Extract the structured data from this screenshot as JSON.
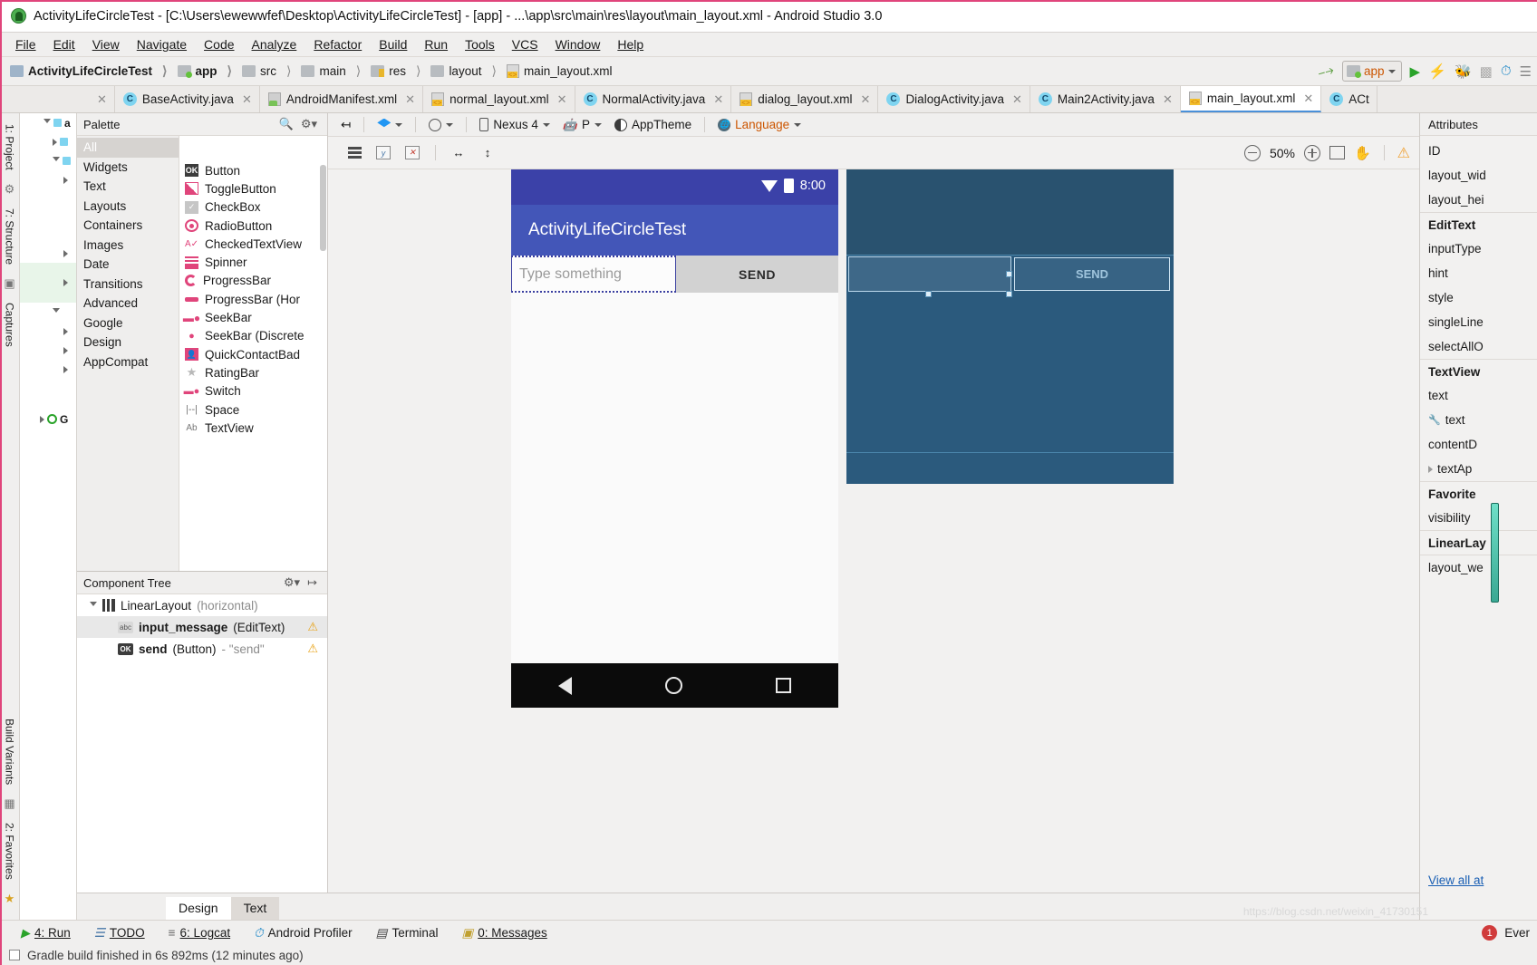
{
  "window": {
    "title": "ActivityLifeCircleTest - [C:\\Users\\ewewwfef\\Desktop\\ActivityLifeCircleTest] - [app] - ...\\app\\src\\main\\res\\layout\\main_layout.xml - Android Studio 3.0",
    "app_icon": "android-studio-icon"
  },
  "menubar": [
    {
      "label": "File"
    },
    {
      "label": "Edit"
    },
    {
      "label": "View"
    },
    {
      "label": "Navigate"
    },
    {
      "label": "Code"
    },
    {
      "label": "Analyze"
    },
    {
      "label": "Refactor"
    },
    {
      "label": "Build"
    },
    {
      "label": "Run"
    },
    {
      "label": "Tools"
    },
    {
      "label": "VCS"
    },
    {
      "label": "Window"
    },
    {
      "label": "Help"
    }
  ],
  "breadcrumbs": [
    {
      "label": "ActivityLifeCircleTest",
      "icon": "module-icon"
    },
    {
      "label": "app",
      "icon": "app-module-icon"
    },
    {
      "label": "src",
      "icon": "folder-icon"
    },
    {
      "label": "main",
      "icon": "folder-icon"
    },
    {
      "label": "res",
      "icon": "res-folder-icon"
    },
    {
      "label": "layout",
      "icon": "folder-icon"
    },
    {
      "label": "main_layout.xml",
      "icon": "xml-file-icon"
    }
  ],
  "toolbar_right": {
    "build_icon": "hammer-icon",
    "run_config": "app",
    "run_icon": "run-icon",
    "apply_changes_icon": "lightning-icon",
    "debug_icon": "debug-icon",
    "profile_icon": "profiler-icon",
    "avd_icon": "avd-manager-icon"
  },
  "editor_tabs": [
    {
      "label": "BaseActivity.java",
      "icon": "java-class-icon",
      "active": false
    },
    {
      "label": "AndroidManifest.xml",
      "icon": "android-manifest-icon",
      "active": false
    },
    {
      "label": "normal_layout.xml",
      "icon": "xml-file-icon",
      "active": false
    },
    {
      "label": "NormalActivity.java",
      "icon": "java-class-icon",
      "active": false
    },
    {
      "label": "dialog_layout.xml",
      "icon": "xml-file-icon",
      "active": false
    },
    {
      "label": "DialogActivity.java",
      "icon": "java-class-icon",
      "active": false
    },
    {
      "label": "Main2Activity.java",
      "icon": "java-class-icon",
      "active": false
    },
    {
      "label": "main_layout.xml",
      "icon": "xml-file-icon",
      "active": true
    },
    {
      "label": "ACt",
      "icon": "java-class-icon",
      "active": false
    }
  ],
  "left_tool_strip": [
    {
      "label": "1: Project"
    },
    {
      "label": "7: Structure"
    },
    {
      "label": "Captures"
    },
    {
      "label": "Build Variants"
    },
    {
      "label": "2: Favorites"
    }
  ],
  "palette": {
    "title": "Palette",
    "search_icon": "search-icon",
    "gear_icon": "gear-icon",
    "groups": [
      {
        "label": "All",
        "selected": true
      },
      {
        "label": "Widgets",
        "selected": false
      },
      {
        "label": "Text",
        "selected": false
      },
      {
        "label": "Layouts",
        "selected": false
      },
      {
        "label": "Containers",
        "selected": false
      },
      {
        "label": "Images",
        "selected": false
      },
      {
        "label": "Date",
        "selected": false
      },
      {
        "label": "Transitions",
        "selected": false
      },
      {
        "label": "Advanced",
        "selected": false
      },
      {
        "label": "Google",
        "selected": false
      },
      {
        "label": "Design",
        "selected": false
      },
      {
        "label": "AppCompat",
        "selected": false
      }
    ],
    "items": [
      {
        "label": "Button",
        "icon": "button-icon"
      },
      {
        "label": "ToggleButton",
        "icon": "toggle-button-icon"
      },
      {
        "label": "CheckBox",
        "icon": "checkbox-icon"
      },
      {
        "label": "RadioButton",
        "icon": "radio-button-icon"
      },
      {
        "label": "CheckedTextView",
        "icon": "checked-textview-icon"
      },
      {
        "label": "Spinner",
        "icon": "spinner-icon"
      },
      {
        "label": "ProgressBar",
        "icon": "progressbar-icon"
      },
      {
        "label": "ProgressBar (Hor",
        "icon": "progressbar-horizontal-icon"
      },
      {
        "label": "SeekBar",
        "icon": "seekbar-icon"
      },
      {
        "label": "SeekBar (Discrete",
        "icon": "seekbar-discrete-icon"
      },
      {
        "label": "QuickContactBad",
        "icon": "quick-contact-badge-icon"
      },
      {
        "label": "RatingBar",
        "icon": "ratingbar-icon"
      },
      {
        "label": "Switch",
        "icon": "switch-icon"
      },
      {
        "label": "Space",
        "icon": "space-icon"
      },
      {
        "label": "TextView",
        "icon": "textview-icon"
      }
    ]
  },
  "component_tree": {
    "title": "Component Tree",
    "gear_icon": "gear-icon",
    "nodes": [
      {
        "name": "LinearLayout",
        "type": "(horizontal)",
        "value": "",
        "icon": "linearlayout-icon",
        "indent": false,
        "selected": false,
        "warning": false
      },
      {
        "name": "input_message",
        "type": "(EditText)",
        "value": "",
        "icon": "edittext-icon",
        "indent": true,
        "selected": true,
        "warning": true
      },
      {
        "name": "send",
        "type": "(Button)",
        "value": " - \"send\"",
        "icon": "button-icon",
        "indent": true,
        "selected": false,
        "warning": true
      }
    ]
  },
  "design_toolbar": {
    "collapse_icon": "collapse-panel-icon",
    "layers_label": "design-mode-icon",
    "orientation_icon": "orientation-icon",
    "device": "Nexus 4",
    "api_level": "P",
    "theme": "AppTheme",
    "language": "Language",
    "device_icon": "phone-icon",
    "api_icon": "android-icon",
    "theme_icon": "theme-icon",
    "language_icon": "globe-icon"
  },
  "design_toolbar2": {
    "list_icon": "list-view-icon",
    "baseline_icon": "baseline-icon",
    "clear_constraints_icon": "clear-constraints-icon",
    "width_icon": "horizontal-resize-icon",
    "height_icon": "vertical-resize-icon",
    "zoom_out_icon": "zoom-out-icon",
    "zoom_level": "50%",
    "zoom_in_icon": "zoom-in-icon",
    "fit_icon": "zoom-to-fit-icon",
    "pan_icon": "pan-hand-icon",
    "warning_icon": "warning-icon"
  },
  "preview": {
    "status_time": "8:00",
    "wifi_icon": "wifi-icon",
    "battery_icon": "battery-icon",
    "app_title": "ActivityLifeCircleTest",
    "edit_hint": "Type something",
    "send_label": "SEND",
    "nav_back_icon": "nav-back-icon",
    "nav_home_icon": "nav-home-icon",
    "nav_recents_icon": "nav-recents-icon"
  },
  "blueprint": {
    "send_label": "SEND"
  },
  "attributes": {
    "title": "Attributes",
    "rows": [
      {
        "label": "ID",
        "group": false,
        "icon": ""
      },
      {
        "label": "layout_wid",
        "group": false,
        "icon": ""
      },
      {
        "label": "layout_hei",
        "group": false,
        "icon": ""
      },
      {
        "label": "EditText",
        "group": true,
        "icon": ""
      },
      {
        "label": "inputType",
        "group": false,
        "icon": ""
      },
      {
        "label": "hint",
        "group": false,
        "icon": ""
      },
      {
        "label": "style",
        "group": false,
        "icon": ""
      },
      {
        "label": "singleLine",
        "group": false,
        "icon": ""
      },
      {
        "label": "selectAllO",
        "group": false,
        "icon": ""
      },
      {
        "label": "TextView",
        "group": true,
        "icon": ""
      },
      {
        "label": "text",
        "group": false,
        "icon": ""
      },
      {
        "label": "text",
        "group": false,
        "icon": "wrench-icon"
      },
      {
        "label": "contentD",
        "group": false,
        "icon": ""
      },
      {
        "label": "textAp",
        "group": false,
        "icon": "expand-arrow-icon"
      },
      {
        "label": "Favorite",
        "group": true,
        "icon": ""
      },
      {
        "label": "visibility",
        "group": false,
        "icon": ""
      },
      {
        "label": "LinearLay",
        "group": true,
        "icon": ""
      },
      {
        "label": "layout_we",
        "group": false,
        "icon": ""
      }
    ],
    "view_all": "View all at"
  },
  "bottom_tabs": [
    {
      "label": "Design",
      "active": true
    },
    {
      "label": "Text",
      "active": false
    }
  ],
  "status_bar": {
    "items": [
      {
        "label": "4: Run",
        "icon": "run-icon"
      },
      {
        "label": "TODO",
        "icon": "todo-icon"
      },
      {
        "label": "6: Logcat",
        "icon": "logcat-icon"
      },
      {
        "label": "Android Profiler",
        "icon": "profiler-icon"
      },
      {
        "label": "Terminal",
        "icon": "terminal-icon"
      },
      {
        "label": "0: Messages",
        "icon": "messages-icon"
      }
    ],
    "event_count": "1",
    "event_label": "Ever"
  },
  "footer": {
    "message": "Gradle build finished in 6s 892ms (12 minutes ago)"
  },
  "watermark": "https://blog.csdn.net/weixin_41730151",
  "colors": {
    "accent_pink": "#e0457b",
    "android_blue": "#4356b8",
    "blueprint": "#2b5a7d",
    "selection": "#d6d3d0"
  }
}
